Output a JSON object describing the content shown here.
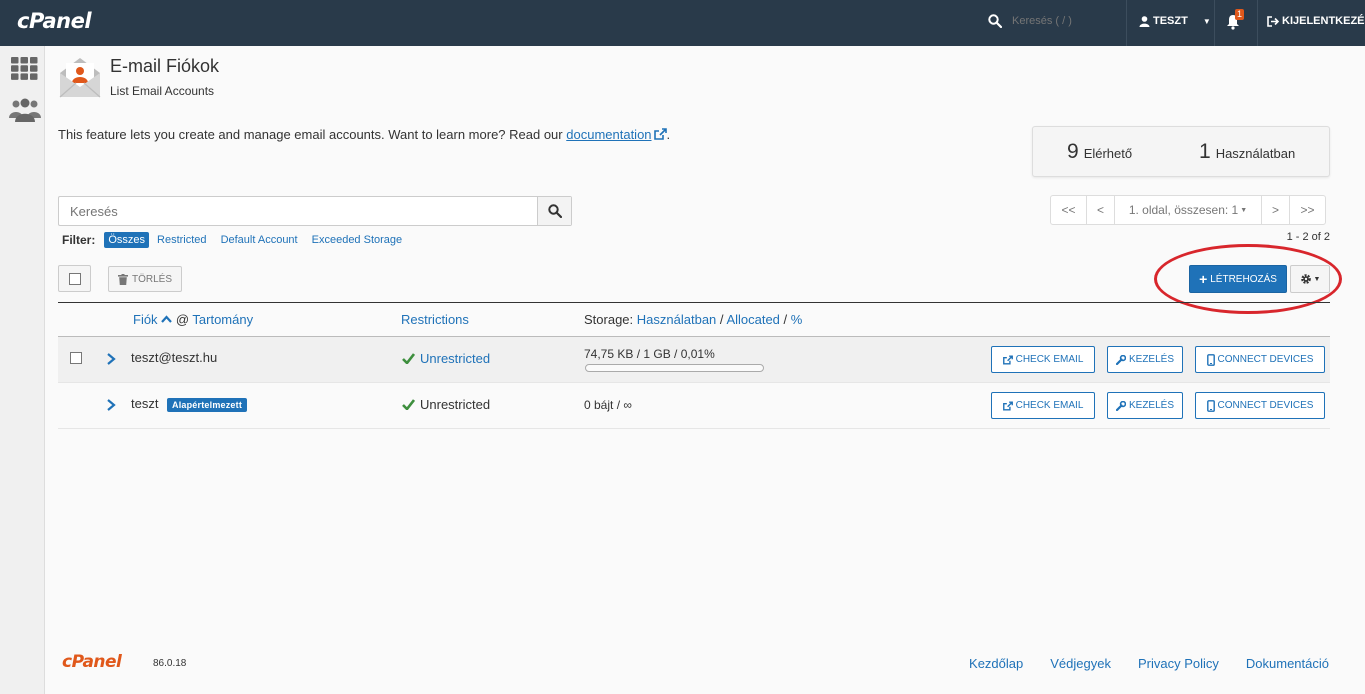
{
  "topbar": {
    "logo": "cPanel",
    "search_placeholder": "Keresés ( / )",
    "user": "TESZT",
    "notification_count": "1",
    "logout": "KIJELENTKEZÉS"
  },
  "header": {
    "title": "E-mail Fiókok",
    "subtitle": "List Email Accounts"
  },
  "intro": {
    "text": "This feature lets you create and manage email accounts. Want to learn more? Read our",
    "link": "documentation",
    "end": "."
  },
  "stats": {
    "available_count": "9",
    "available_label": "Elérhető",
    "used_count": "1",
    "used_label": "Használatban"
  },
  "search": {
    "placeholder": "Keresés",
    "value": ""
  },
  "pagination": {
    "first": "<<",
    "prev": "<",
    "page_label": "1. oldal, összesen: 1",
    "next": ">",
    "last": ">>",
    "range": "1 - 2 of 2"
  },
  "filters": {
    "label": "Filter:",
    "items": [
      "Összes",
      "Restricted",
      "Default Account",
      "Exceeded Storage"
    ],
    "active": "Összes"
  },
  "toolbar": {
    "delete": "TÖRLÉS",
    "create": "LÉTREHOZÁS"
  },
  "table": {
    "headers": {
      "account": "Fiók",
      "at": "@",
      "domain": "Tartomány",
      "restrictions": "Restrictions",
      "storage_prefix": "Storage:",
      "storage_used": "Használatban",
      "storage_sep1": "/",
      "storage_allocated": "Allocated",
      "storage_sep2": "/",
      "storage_percent": "%"
    },
    "rows": [
      {
        "account": "teszt@teszt.hu",
        "badge": "",
        "restriction": "Unrestricted",
        "storage": "74,75 KB / 1 GB / 0,01%",
        "storage_percent": 0.01,
        "check_email": "CHECK EMAIL",
        "manage": "KEZELÉS",
        "connect": "CONNECT DEVICES"
      },
      {
        "account": "teszt",
        "badge": "Alapértelmezett",
        "restriction": "Unrestricted",
        "storage": "0 bájt / ∞",
        "check_email": "CHECK EMAIL",
        "manage": "KEZELÉS",
        "connect": "CONNECT DEVICES"
      }
    ]
  },
  "footer": {
    "logo": "cPanel",
    "version": "86.0.18",
    "links": [
      "Kezdőlap",
      "Védjegyek",
      "Privacy Policy",
      "Dokumentáció"
    ]
  },
  "colors": {
    "topbar": "#293a4a",
    "accent": "#1f72b8",
    "brand_orange": "#e0581b",
    "highlight": "#d8262c",
    "success": "#3e8f3e"
  }
}
